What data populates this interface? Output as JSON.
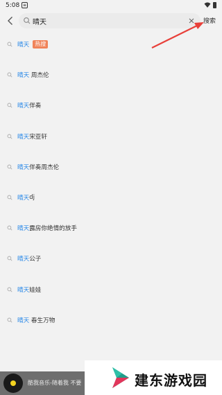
{
  "status_bar": {
    "time": "5:08",
    "notification_icon": "notification-icon",
    "wifi_icon": "wifi-icon",
    "battery_icon": "battery-icon"
  },
  "search": {
    "value": "晴天",
    "button_label": "搜索",
    "back_icon": "back-arrow-icon",
    "search_icon": "search-icon",
    "clear_icon": "close-icon"
  },
  "suggestions": [
    {
      "highlight": "晴天",
      "rest": "",
      "badge": "热搜"
    },
    {
      "highlight": "晴天",
      "rest": " 周杰伦",
      "badge": ""
    },
    {
      "highlight": "晴天",
      "rest": "伴奏",
      "badge": ""
    },
    {
      "highlight": "晴天",
      "rest": "宋亚轩",
      "badge": ""
    },
    {
      "highlight": "晴天",
      "rest": "伴奏周杰伦",
      "badge": ""
    },
    {
      "highlight": "晴天",
      "rest": "dj",
      "badge": ""
    },
    {
      "highlight": "晴天",
      "rest": "露房你绝情的放手",
      "badge": ""
    },
    {
      "highlight": "晴天",
      "rest": "公子",
      "badge": ""
    },
    {
      "highlight": "晴天",
      "rest": "娃娃",
      "badge": ""
    },
    {
      "highlight": "晴天",
      "rest": " 春生万物",
      "badge": ""
    }
  ],
  "player": {
    "text": "酷我音乐-随着我 不要"
  },
  "watermark": {
    "text": "建东游戏园"
  },
  "colors": {
    "highlight": "#2c8ae8",
    "badge": "#f08359",
    "arrow": "#e8403a"
  }
}
